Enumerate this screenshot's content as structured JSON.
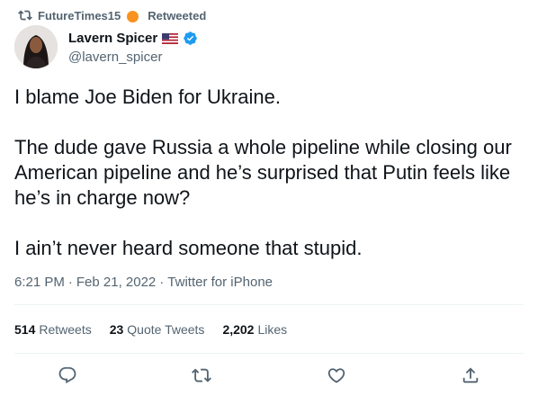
{
  "retweet_banner": {
    "user": "FutureTimes15",
    "label": "Retweeted",
    "icon": "retweet-icon",
    "emoji_color": "#f7931e"
  },
  "author": {
    "display_name": "Lavern Spicer",
    "handle": "@lavern_spicer",
    "flag_icon": "us-flag-icon",
    "verified_icon": "verified-badge-icon",
    "verified_color": "#1d9bf0"
  },
  "tweet": {
    "paragraphs": [
      "I blame Joe Biden for Ukraine.",
      "The dude gave Russia a whole pipeline while closing our American pipeline and he’s surprised that Putin feels like he’s in charge now?",
      "I ain’t never heard someone that stupid."
    ]
  },
  "meta": {
    "time": "6:21 PM",
    "sep1": "·",
    "date": "Feb 21, 2022",
    "sep2": "·",
    "source": "Twitter for iPhone"
  },
  "stats": [
    {
      "count": "514",
      "label": "Retweets"
    },
    {
      "count": "23",
      "label": "Quote Tweets"
    },
    {
      "count": "2,202",
      "label": "Likes"
    }
  ],
  "actions": [
    "reply-icon",
    "retweet-icon",
    "like-icon",
    "share-icon"
  ],
  "colors": {
    "text": "#0f1419",
    "secondary": "#536471",
    "divider": "#eff3f4"
  }
}
